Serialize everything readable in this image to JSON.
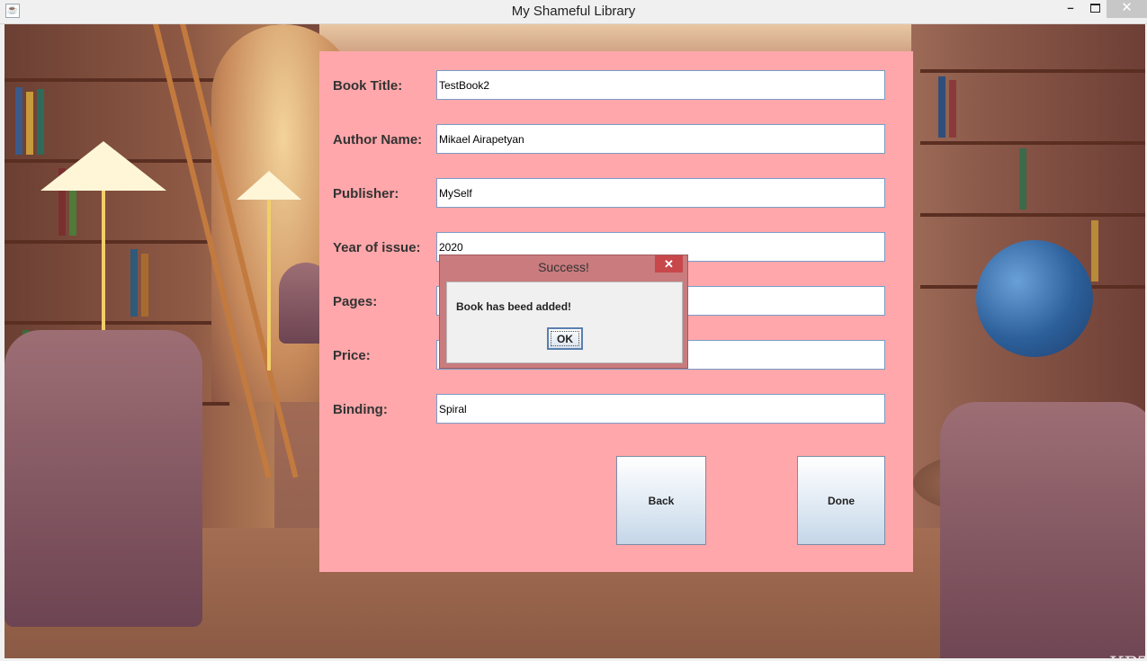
{
  "window": {
    "title": "My Shameful Library",
    "minimize_label": "–",
    "close_label": "✕"
  },
  "form": {
    "fields": [
      {
        "label": "Book Title:",
        "value": "TestBook2"
      },
      {
        "label": "Author Name:",
        "value": "Mikael Airapetyan"
      },
      {
        "label": "Publisher:",
        "value": "MySelf"
      },
      {
        "label": "Year of issue:",
        "value": "2020"
      },
      {
        "label": "Pages:",
        "value": ""
      },
      {
        "label": "Price:",
        "value": ""
      },
      {
        "label": "Binding:",
        "value": "Spiral"
      }
    ],
    "back_label": "Back",
    "done_label": "Done"
  },
  "dialog": {
    "title": "Success!",
    "message": "Book has beed added!",
    "ok_label": "OK",
    "close_label": "✕"
  },
  "colors": {
    "panel": "#ffa7aa",
    "dialog_frame": "#c97b7d",
    "dialog_close": "#c7474a"
  },
  "icons": {
    "app": "java-cup-icon",
    "minimize": "minimize-icon",
    "maximize": "maximize-icon",
    "close": "close-icon"
  }
}
